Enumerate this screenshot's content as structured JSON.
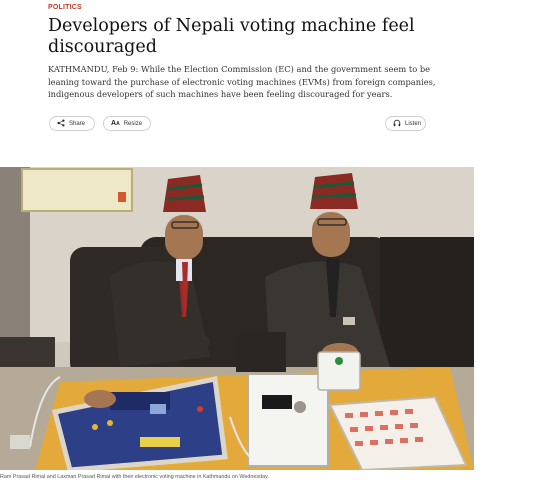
{
  "article": {
    "category": "POLITICS",
    "headline": "Developers of Nepali voting machine feel discouraged",
    "lede": "KATHMANDU, Feb 9: While the Election Commission (EC) and the government seem to be leaning toward the purchase of electronic voting machines (EVMs) from foreign companies, indigenous developers of such machines have been feeling discouraged for years.",
    "photo_caption": "Ram Prasad Rimal and Laxman Prasad Rimal with their electronic voting machine in Kathmandu on Wednesday."
  },
  "actions": {
    "share_label": "Share",
    "resize_label": "Resize",
    "listen_label": "Listen"
  },
  "icons": {
    "share": "share-icon",
    "resize": "text-resize-icon",
    "listen": "headphones-icon"
  },
  "colors": {
    "category": "#c0392b",
    "headline": "#111111",
    "border": "#cfcfcf"
  }
}
